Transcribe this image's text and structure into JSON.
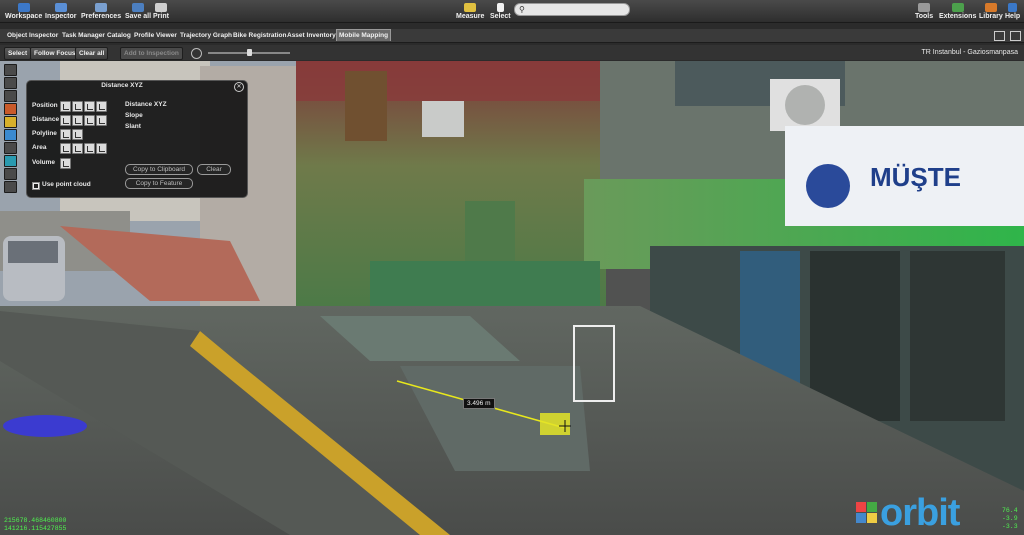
{
  "toolbar": {
    "workspace": "Workspace",
    "inspector": "Inspector",
    "preferences": "Preferences",
    "save_all": "Save all",
    "print": "Print",
    "measure": "Measure",
    "select": "Select",
    "tools": "Tools",
    "extensions": "Extensions",
    "library": "Library",
    "help": "Help"
  },
  "tabs": [
    "Object Inspector",
    "Task Manager",
    "Catalog",
    "Profile Viewer",
    "Trajectory Graph",
    "Bike Registration",
    "Asset Inventory",
    "Mobile Mapping"
  ],
  "subtoolbar": {
    "select": "Select",
    "follow_focus": "Follow Focus",
    "clear_all": "Clear all",
    "add_inspection": "Add to Inspection",
    "location": "TR Instanbul - Gaziosmanpasa",
    "slider_value": 0.5
  },
  "panel": {
    "title": "Distance XYZ",
    "rows": [
      "Position",
      "Distance",
      "Polyline",
      "Area",
      "Volume"
    ],
    "measure_labels": [
      "Distance XYZ",
      "Slope",
      "Slant"
    ],
    "copy_clipboard": "Copy to Clipboard",
    "clear": "Clear",
    "copy_feature": "Copy to Feature",
    "use_point_cloud": "Use point cloud",
    "use_point_cloud_checked": true
  },
  "measurement": {
    "label": "3.496 m"
  },
  "coordinates": {
    "line1": "215678.468460800",
    "line2": "141216.115427855"
  },
  "right_readout": {
    "line1": "76.4",
    "line2": "-3.9",
    "line3": "-3.3"
  },
  "brand": {
    "name": "orbit"
  },
  "colors": {
    "accent": "#3aa0e0",
    "measure_line": "#e8e81c",
    "coords": "#4ff24f"
  }
}
